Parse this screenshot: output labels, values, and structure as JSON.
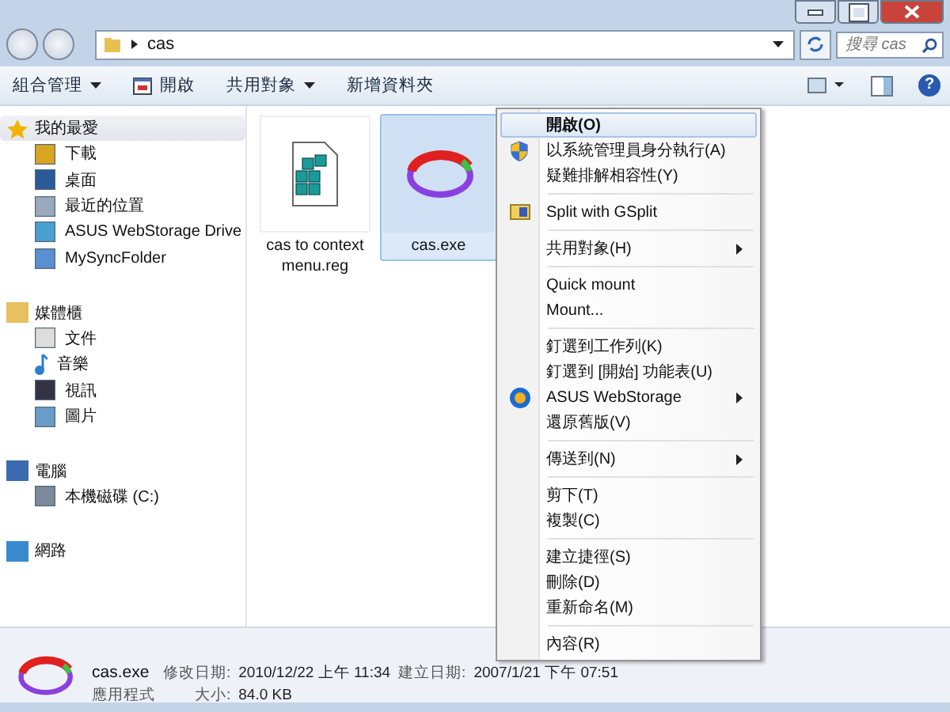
{
  "address_bar": {
    "path": "cas",
    "search_placeholder": "搜尋 cas"
  },
  "toolbar": {
    "buttons": [
      {
        "label": "組合管理",
        "dropdown": true
      },
      {
        "label": "開啟",
        "dropdown": false
      },
      {
        "label": "共用對象",
        "dropdown": true
      },
      {
        "label": "新增資料夾",
        "dropdown": false
      }
    ],
    "help": "?"
  },
  "sidebar": {
    "groups": [
      {
        "label": "我的最愛",
        "selected": true,
        "children": [
          {
            "label": "下載"
          },
          {
            "label": "桌面"
          },
          {
            "label": "最近的位置"
          },
          {
            "label": "ASUS WebStorage Drive"
          },
          {
            "label": "MySyncFolder"
          }
        ]
      },
      {
        "label": "媒體櫃",
        "selected": false,
        "children": [
          {
            "label": "文件"
          },
          {
            "label": "音樂"
          },
          {
            "label": "視訊"
          },
          {
            "label": "圖片"
          }
        ]
      },
      {
        "label": "電腦",
        "selected": false,
        "children": [
          {
            "label": "本機磁碟 (C:)"
          }
        ]
      },
      {
        "label": "網路",
        "selected": false
      }
    ]
  },
  "files": [
    {
      "name": "cas to context menu.reg",
      "kind": "reg",
      "selected": false
    },
    {
      "name": "cas.exe",
      "kind": "exe",
      "selected": true
    }
  ],
  "context_menu": [
    {
      "kind": "item",
      "label": "開啟(O)",
      "bold": true,
      "submenu": false,
      "selected": true
    },
    {
      "kind": "item",
      "label": "以系統管理員身分執行(A)",
      "bold": false,
      "submenu": false,
      "selected": false
    },
    {
      "kind": "item",
      "label": "疑難排解相容性(Y)",
      "bold": false,
      "submenu": false,
      "selected": false
    },
    {
      "kind": "separator"
    },
    {
      "kind": "item",
      "label": "Split with GSplit",
      "bold": false,
      "submenu": false,
      "selected": false
    },
    {
      "kind": "separator"
    },
    {
      "kind": "item",
      "label": "共用對象(H)",
      "bold": false,
      "submenu": true,
      "selected": false
    },
    {
      "kind": "separator"
    },
    {
      "kind": "item",
      "label": "Quick mount",
      "bold": false,
      "submenu": false,
      "selected": false
    },
    {
      "kind": "item",
      "label": "Mount...",
      "bold": false,
      "submenu": false,
      "selected": false
    },
    {
      "kind": "separator"
    },
    {
      "kind": "item",
      "label": "釘選到工作列(K)",
      "bold": false,
      "submenu": false,
      "selected": false
    },
    {
      "kind": "item",
      "label": "釘選到 [開始] 功能表(U)",
      "bold": false,
      "submenu": false,
      "selected": false
    },
    {
      "kind": "item",
      "label": "ASUS WebStorage",
      "bold": false,
      "submenu": true,
      "selected": false
    },
    {
      "kind": "item",
      "label": "還原舊版(V)",
      "bold": false,
      "submenu": false,
      "selected": false
    },
    {
      "kind": "separator"
    },
    {
      "kind": "item",
      "label": "傳送到(N)",
      "bold": false,
      "submenu": true,
      "selected": false
    },
    {
      "kind": "separator"
    },
    {
      "kind": "item",
      "label": "剪下(T)",
      "bold": false,
      "submenu": false,
      "selected": false
    },
    {
      "kind": "item",
      "label": "複製(C)",
      "bold": false,
      "submenu": false,
      "selected": false
    },
    {
      "kind": "separator"
    },
    {
      "kind": "item",
      "label": "建立捷徑(S)",
      "bold": false,
      "submenu": false,
      "selected": false
    },
    {
      "kind": "item",
      "label": "刪除(D)",
      "bold": false,
      "submenu": false,
      "selected": false
    },
    {
      "kind": "item",
      "label": "重新命名(M)",
      "bold": false,
      "submenu": false,
      "selected": false
    },
    {
      "kind": "separator"
    },
    {
      "kind": "item",
      "label": "內容(R)",
      "bold": false,
      "submenu": false,
      "selected": false
    }
  ],
  "details_pane": {
    "name": "cas.exe",
    "type": "應用程式",
    "fields": [
      {
        "label": "修改日期:",
        "value": "2010/12/22 上午 11:34"
      },
      {
        "label": "建立日期:",
        "value": "2007/1/21 下午 07:51"
      },
      {
        "label": "大小:",
        "value": "84.0 KB"
      }
    ]
  }
}
